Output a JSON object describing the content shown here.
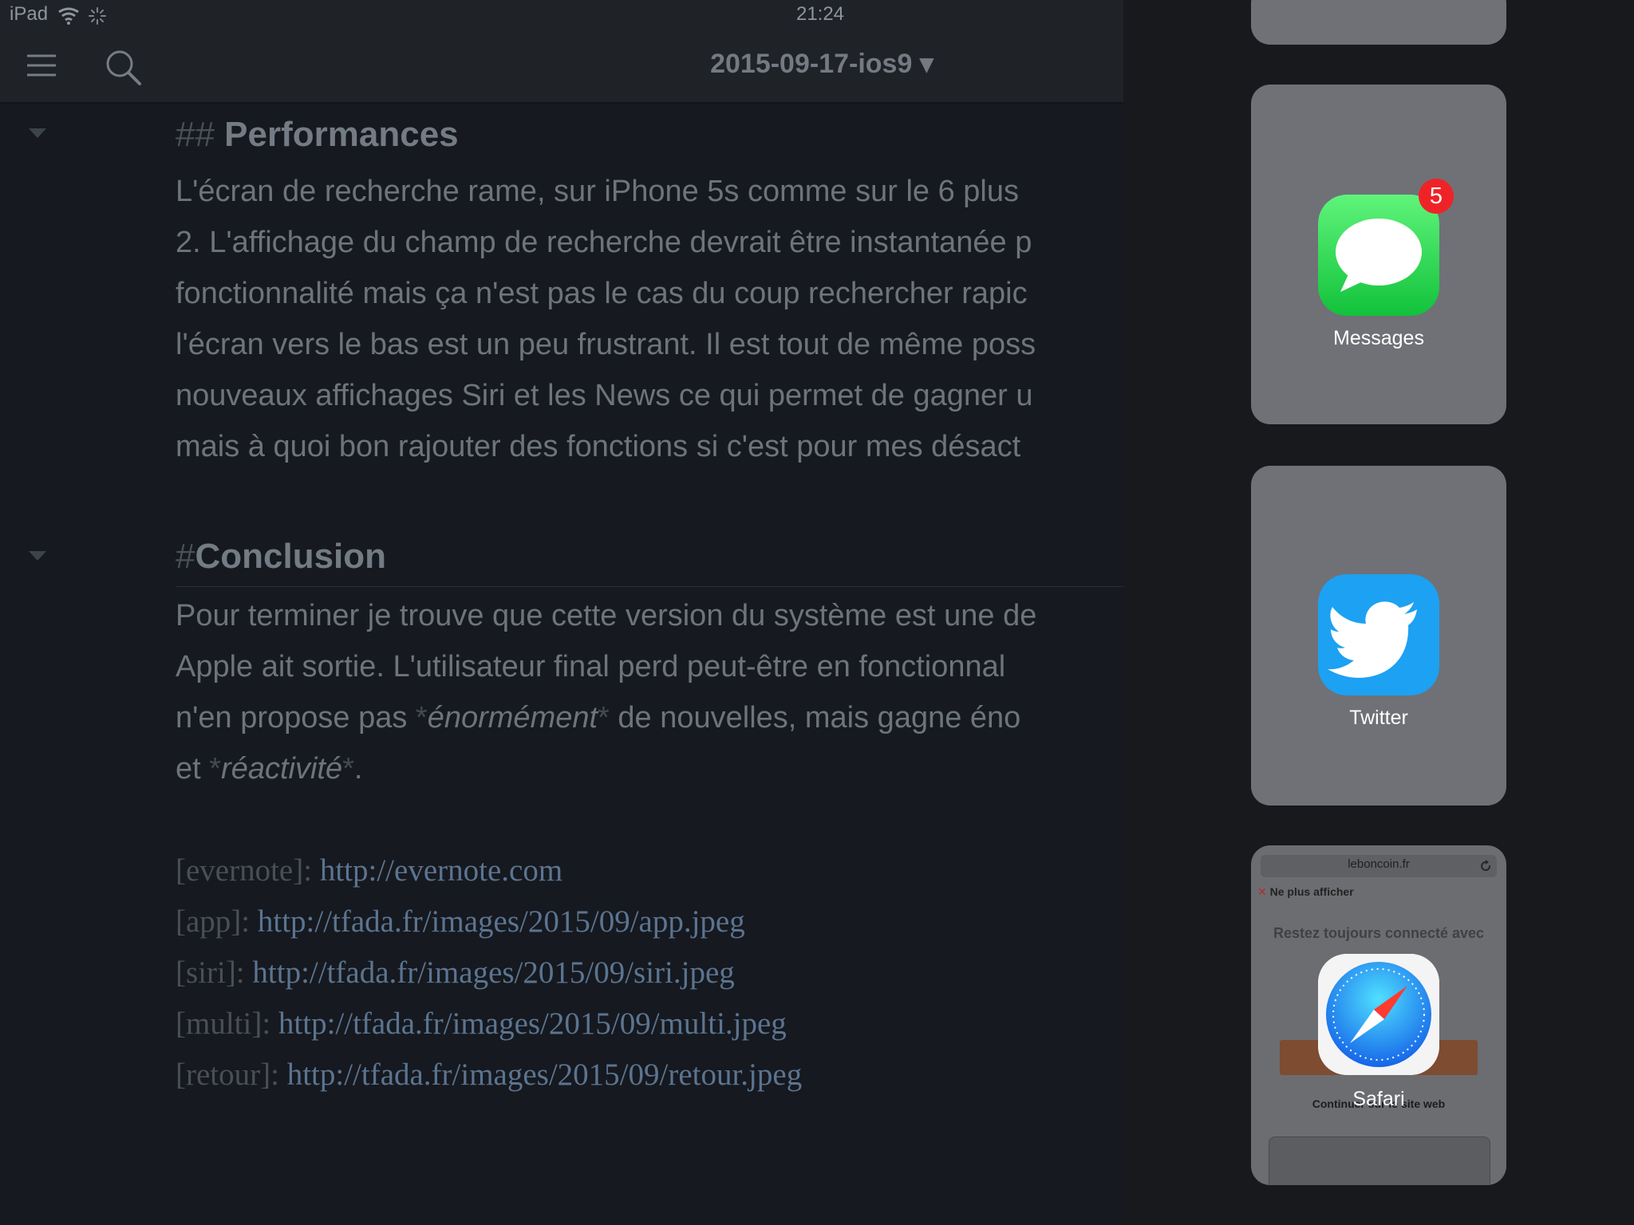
{
  "status_bar": {
    "device": "iPad",
    "time": "21:24"
  },
  "toolbar": {
    "document_title": "2015-09-17-ios9 ▾"
  },
  "editor": {
    "section_1": {
      "heading_mark": "## ",
      "heading_text": "Performances",
      "lines": [
        "L'écran de recherche rame, sur iPhone 5s comme sur le 6 plus",
        "2. L'affichage du champ de recherche devrait être instantanée p",
        "fonctionnalité mais ça n'est pas le cas du coup rechercher rapic",
        "l'écran vers le bas est un peu frustrant. Il est tout de même poss",
        "nouveaux affichages Siri et les News ce qui permet de gagner u",
        "mais à quoi bon rajouter des fonctions si c'est pour mes désact"
      ]
    },
    "section_2": {
      "heading_mark": "#",
      "heading_text": "Conclusion",
      "lines": [
        "Pour terminer je trouve que cette version du système est une de",
        "Apple ait sortie. L'utilisateur final perd peut-être en fonctionnal"
      ],
      "line_3_before": "n'en propose pas ",
      "line_3_mark_open": "*",
      "line_3_em": "énormément",
      "line_3_mark_close": "*",
      "line_3_after": " de nouvelles, mais gagne éno",
      "line_4_before": "et ",
      "line_4_mark_open": "*",
      "line_4_em": "réactivité",
      "line_4_mark_close": "*",
      "line_4_after": "."
    },
    "links": [
      {
        "key": "[evernote]: ",
        "url": "http://evernote.com"
      },
      {
        "key": "[app]: ",
        "url": "http://tfada.fr/images/2015/09/app.jpeg"
      },
      {
        "key": "[siri]: ",
        "url": "http://tfada.fr/images/2015/09/siri.jpeg"
      },
      {
        "key": "[multi]: ",
        "url": "http://tfada.fr/images/2015/09/multi.jpeg"
      },
      {
        "key": "[retour]: ",
        "url": "http://tfada.fr/images/2015/09/retour.jpeg"
      }
    ]
  },
  "switcher": {
    "messages": {
      "label": "Messages",
      "badge": "5"
    },
    "twitter": {
      "label": "Twitter"
    },
    "safari": {
      "label": "Safari",
      "preview_url": "leboncoin.fr",
      "preview_dismiss": "Ne plus afficher",
      "preview_promo": "Restez toujours connecté avec",
      "preview_continue": "Continuer sur le site web"
    }
  },
  "colors": {
    "messages": "#34c759",
    "twitter": "#1da1f2",
    "badge": "#ef2327",
    "link": "#5b7491"
  },
  "icons": [
    "wifi-icon",
    "spinner-icon",
    "menu-icon",
    "search-icon",
    "fold-icon",
    "chat-bubble-icon",
    "twitter-bird-icon",
    "safari-compass-icon",
    "reload-icon"
  ]
}
